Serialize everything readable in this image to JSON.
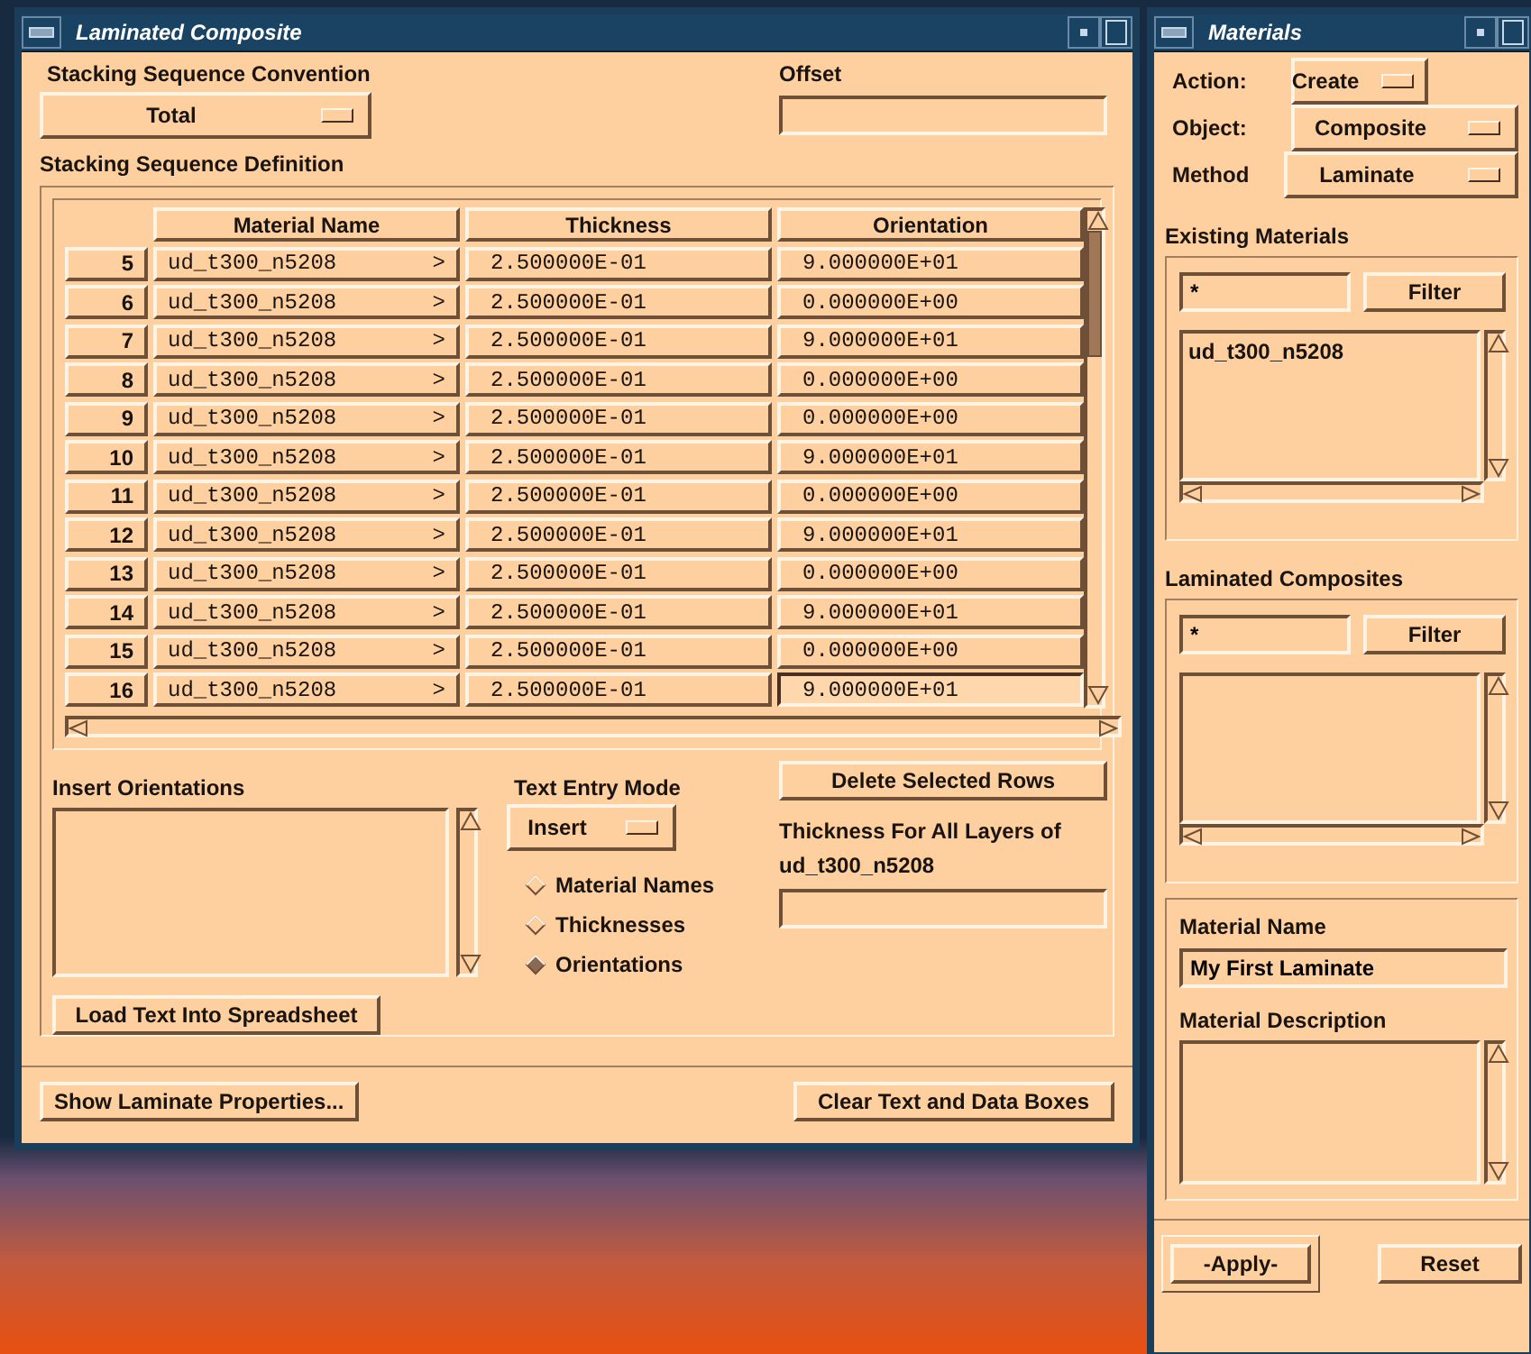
{
  "laminated_window": {
    "title": "Laminated Composite",
    "convention": {
      "label": "Stacking Sequence Convention",
      "value": "Total"
    },
    "offset": {
      "label": "Offset"
    },
    "definition_label": "Stacking Sequence Definition",
    "table": {
      "columns": [
        "Material Name",
        "Thickness",
        "Orientation"
      ],
      "rows": [
        {
          "index": "5",
          "material": "ud_t300_n5208",
          "mark": ">",
          "thickness": "2.500000E-01",
          "orientation": "9.000000E+01",
          "focused": false
        },
        {
          "index": "6",
          "material": "ud_t300_n5208",
          "mark": ">",
          "thickness": "2.500000E-01",
          "orientation": "0.000000E+00",
          "focused": false
        },
        {
          "index": "7",
          "material": "ud_t300_n5208",
          "mark": ">",
          "thickness": "2.500000E-01",
          "orientation": "9.000000E+01",
          "focused": false
        },
        {
          "index": "8",
          "material": "ud_t300_n5208",
          "mark": ">",
          "thickness": "2.500000E-01",
          "orientation": "0.000000E+00",
          "focused": false
        },
        {
          "index": "9",
          "material": "ud_t300_n5208",
          "mark": ">",
          "thickness": "2.500000E-01",
          "orientation": "0.000000E+00",
          "focused": false
        },
        {
          "index": "10",
          "material": "ud_t300_n5208",
          "mark": ">",
          "thickness": "2.500000E-01",
          "orientation": "9.000000E+01",
          "focused": false
        },
        {
          "index": "11",
          "material": "ud_t300_n5208",
          "mark": ">",
          "thickness": "2.500000E-01",
          "orientation": "0.000000E+00",
          "focused": false
        },
        {
          "index": "12",
          "material": "ud_t300_n5208",
          "mark": ">",
          "thickness": "2.500000E-01",
          "orientation": "9.000000E+01",
          "focused": false
        },
        {
          "index": "13",
          "material": "ud_t300_n5208",
          "mark": ">",
          "thickness": "2.500000E-01",
          "orientation": "0.000000E+00",
          "focused": false
        },
        {
          "index": "14",
          "material": "ud_t300_n5208",
          "mark": ">",
          "thickness": "2.500000E-01",
          "orientation": "9.000000E+01",
          "focused": false
        },
        {
          "index": "15",
          "material": "ud_t300_n5208",
          "mark": ">",
          "thickness": "2.500000E-01",
          "orientation": "0.000000E+00",
          "focused": false
        },
        {
          "index": "16",
          "material": "ud_t300_n5208",
          "mark": ">",
          "thickness": "2.500000E-01",
          "orientation": "9.000000E+01",
          "focused": true
        }
      ]
    },
    "insert": {
      "label": "Insert Orientations",
      "button": "Load Text Into Spreadsheet"
    },
    "entry_mode": {
      "label": "Text Entry Mode",
      "value": "Insert",
      "options": [
        {
          "label": "Material Names",
          "selected": false
        },
        {
          "label": "Thicknesses",
          "selected": false
        },
        {
          "label": "Orientations",
          "selected": true
        }
      ]
    },
    "delete_button": "Delete Selected Rows",
    "thickness": {
      "label": "Thickness For All Layers of",
      "material": "ud_t300_n5208"
    },
    "footer_buttons": [
      "Show Laminate Properties...",
      "Clear Text and Data Boxes"
    ]
  },
  "materials_window": {
    "title": "Materials",
    "selectors": [
      {
        "label": "Action:",
        "value": "Create"
      },
      {
        "label": "Object:",
        "value": "Composite"
      },
      {
        "label": "Method",
        "value": "Laminate"
      }
    ],
    "existing": {
      "label": "Existing Materials",
      "filter_value": "*",
      "filter_button": "Filter",
      "items": [
        "ud_t300_n5208"
      ]
    },
    "laminated": {
      "label": "Laminated Composites",
      "filter_value": "*",
      "filter_button": "Filter"
    },
    "name": {
      "label": "Material Name",
      "value": "My First Laminate"
    },
    "description": {
      "label": "Material Description"
    },
    "buttons": [
      {
        "label": "-Apply-",
        "default": true
      },
      {
        "label": "Reset",
        "default": false
      }
    ]
  }
}
